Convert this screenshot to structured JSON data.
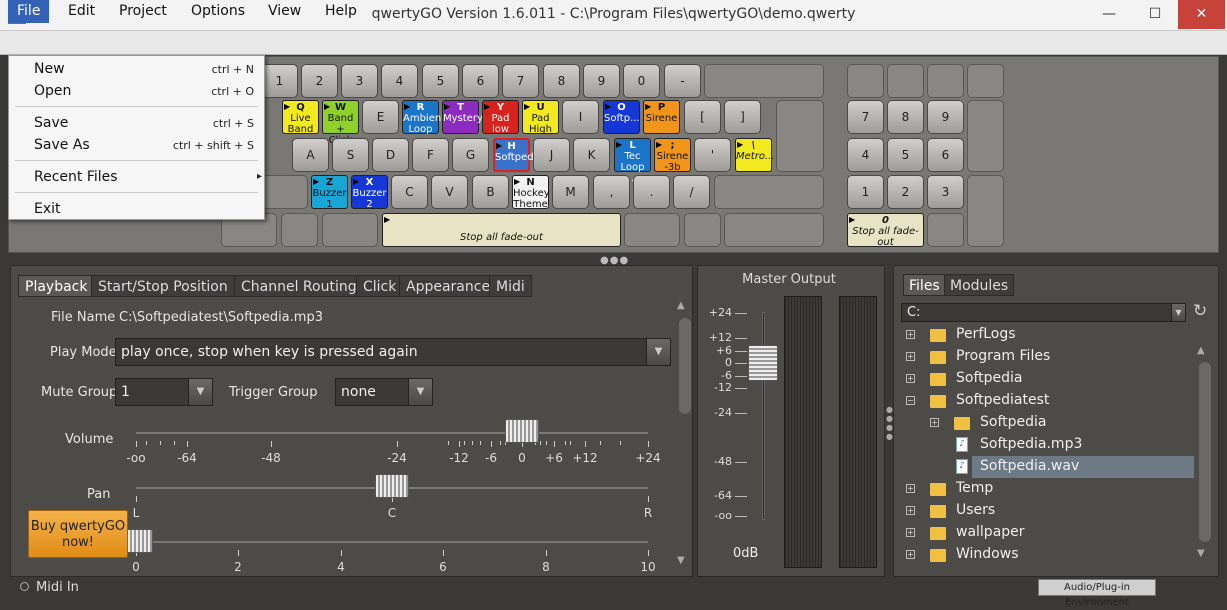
{
  "window": {
    "title": "qwertyGO Version 1.6.011 - C:\\Program Files\\qwertyGO\\demo.qwerty",
    "app_icon": "Q",
    "minimize": "—",
    "maximize": "☐",
    "close": "✕"
  },
  "menu": {
    "file": "File",
    "edit": "Edit",
    "project": "Project",
    "options": "Options",
    "view": "View",
    "help": "Help"
  },
  "file_menu": [
    {
      "label": "New",
      "shortcut": "ctrl + N"
    },
    {
      "label": "Open",
      "shortcut": "ctrl + O"
    },
    {
      "label": "Save",
      "shortcut": "ctrl + S"
    },
    {
      "label": "Save As",
      "shortcut": "ctrl + shift + S"
    },
    {
      "label": "Recent Files",
      "shortcut": "▸"
    },
    {
      "label": "Exit",
      "shortcut": ""
    }
  ],
  "keys": {
    "row1": [
      "1",
      "2",
      "3",
      "4",
      "5",
      "6",
      "7",
      "8",
      "9",
      "0",
      "-"
    ],
    "row2_plain": [
      "E",
      "I",
      "[",
      "]"
    ],
    "row3_plain": [
      "A",
      "S",
      "D",
      "F",
      "G",
      "J",
      "K",
      "'"
    ],
    "row4_plain": [
      "C",
      "V",
      "B",
      "M",
      ",",
      ".",
      "/"
    ],
    "numpad": [
      "7",
      "8",
      "9",
      "4",
      "5",
      "6",
      "1",
      "2",
      "3"
    ]
  },
  "assigned_keys": [
    {
      "key": "Q",
      "label": "Live Band",
      "color": "#f2ea1e"
    },
    {
      "key": "W",
      "label": "Band + Click",
      "color": "#8fd12a"
    },
    {
      "key": "R",
      "label": "Ambient Loop",
      "color": "#1c74c8"
    },
    {
      "key": "T",
      "label": "Mystery",
      "color": "#8d2bc1"
    },
    {
      "key": "Y",
      "label": "Pad low",
      "color": "#d8221d"
    },
    {
      "key": "U",
      "label": "Pad High",
      "color": "#f2ea1e"
    },
    {
      "key": "O",
      "label": "Softp...",
      "color": "#1437d6"
    },
    {
      "key": "P",
      "label": "Sirene",
      "color": "#f0941a"
    },
    {
      "key": "H",
      "label": "SoftpediaTest",
      "color": "#3a72c9"
    },
    {
      "key": "L",
      "label": "Tec Loop ...",
      "color": "#1c74c8"
    },
    {
      "key": ";",
      "label": "Sirene -3b",
      "color": "#f0941a"
    },
    {
      "key": "\\",
      "label": "Metro...",
      "color": "#f2ea1e"
    },
    {
      "key": "Z",
      "label": "Buzzer 1",
      "color": "#19a6d6"
    },
    {
      "key": "X",
      "label": "Buzzer 2",
      "color": "#1437d6"
    },
    {
      "key": "N",
      "label": "Hockey Theme",
      "color": "#f2f2f2"
    },
    {
      "key": "",
      "label": "Stop all fade-out",
      "color": "#e8e3c4"
    },
    {
      "key": "0",
      "label": "Stop all fade-out",
      "color": "#e8e3c4"
    }
  ],
  "tabs": [
    "Playback",
    "Start/Stop Position",
    "Channel Routing",
    "Click",
    "Appearance",
    "Midi"
  ],
  "playback": {
    "file_name_label": "File Name",
    "file_name": "C:\\Softpediatest\\Softpedia.mp3",
    "play_mode_label": "Play Mode",
    "play_mode": "play once, stop when key is pressed again",
    "mute_group_label": "Mute Group",
    "mute_group": "1",
    "trigger_group_label": "Trigger Group",
    "trigger_group": "none",
    "volume_label": "Volume",
    "volume_ticks": [
      "-oo",
      "-64",
      "-48",
      "-24",
      "-12",
      "-6",
      "0",
      "+6",
      "+12",
      "+24"
    ],
    "volume_db": 0,
    "pan_label": "Pan",
    "pan_ticks": [
      "L",
      "C",
      "R"
    ],
    "pan": 0,
    "third_ticks": [
      "0",
      "2",
      "4",
      "6",
      "8",
      "10"
    ],
    "third_value": 0,
    "buy_button": "Buy qwertyGO now!"
  },
  "master": {
    "title": "Master Output",
    "scale": [
      "+24",
      "+12",
      "+6",
      "0",
      "-6",
      "-12",
      "-24",
      "-48",
      "-64",
      "-oo"
    ],
    "readout": "0dB"
  },
  "browser": {
    "tabs": [
      "Files",
      "Modules"
    ],
    "drive": "C:",
    "tree": [
      {
        "label": "PerfLogs",
        "type": "folder",
        "level": 0,
        "exp": "+"
      },
      {
        "label": "Program Files",
        "type": "folder",
        "level": 0,
        "exp": "+"
      },
      {
        "label": "Softpedia",
        "type": "folder",
        "level": 0,
        "exp": "+"
      },
      {
        "label": "Softpediatest",
        "type": "folder",
        "level": 0,
        "exp": "−"
      },
      {
        "label": "Softpedia",
        "type": "folder",
        "level": 1,
        "exp": "+"
      },
      {
        "label": "Softpedia.mp3",
        "type": "file",
        "level": 1,
        "exp": ""
      },
      {
        "label": "Softpedia.wav",
        "type": "file",
        "level": 1,
        "exp": "",
        "selected": true
      },
      {
        "label": "Temp",
        "type": "folder",
        "level": 0,
        "exp": "+"
      },
      {
        "label": "Users",
        "type": "folder",
        "level": 0,
        "exp": "+"
      },
      {
        "label": "wallpaper",
        "type": "folder",
        "level": 0,
        "exp": "+"
      },
      {
        "label": "Windows",
        "type": "folder",
        "level": 0,
        "exp": "+"
      }
    ]
  },
  "status": {
    "midi": "Midi In",
    "env_button": "Audio/Plug-in Environment"
  }
}
